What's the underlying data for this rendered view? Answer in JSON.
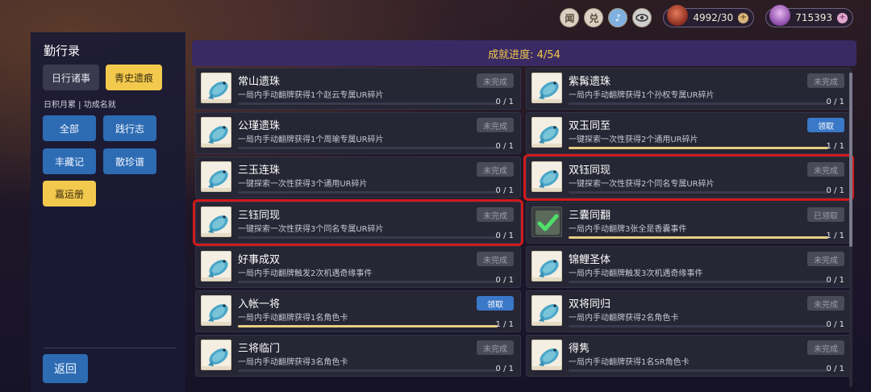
{
  "topbar": {
    "icons": [
      {
        "name": "wen-icon",
        "glyph": "闻"
      },
      {
        "name": "dui-icon",
        "glyph": "兑"
      },
      {
        "name": "music-icon",
        "glyph": "♪"
      },
      {
        "name": "eye-icon",
        "glyph": "👁"
      }
    ],
    "currency1": "4992/30",
    "currency2": "715393",
    "plus": "+"
  },
  "sidebar": {
    "title": "勤行录",
    "tabs": [
      "日行诸事",
      "青史遗痕"
    ],
    "subtitle": "日积月累 | 功成名就",
    "filters": [
      "全部",
      "践行志",
      "丰藏记",
      "散珍谱",
      "嘉运册"
    ],
    "back": "返回"
  },
  "header": {
    "progress": "成就进度: 4/54"
  },
  "achievements": {
    "left": [
      {
        "title": "常山遗珠",
        "desc": "一局内手动翻牌获得1个赵云专属UR碎片",
        "status": "未完成",
        "count": "0 / 1",
        "progress": 0
      },
      {
        "title": "公瑾遗珠",
        "desc": "一局内手动翻牌获得1个周瑜专属UR碎片",
        "status": "未完成",
        "count": "0 / 1",
        "progress": 0
      },
      {
        "title": "三玉连珠",
        "desc": "一键探索一次性获得3个通用UR碎片",
        "status": "未完成",
        "count": "0 / 1",
        "progress": 0
      },
      {
        "title": "三钰同现",
        "desc": "一键探索一次性获得3个同名专属UR碎片",
        "status": "未完成",
        "count": "0 / 1",
        "progress": 0
      },
      {
        "title": "好事成双",
        "desc": "一局内手动翻牌触发2次机遇奇缘事件",
        "status": "未完成",
        "count": "0 / 1",
        "progress": 0
      },
      {
        "title": "入帐一将",
        "desc": "一局内手动翻牌获得1名角色卡",
        "status": "领取",
        "count": "1 / 1",
        "progress": 1
      },
      {
        "title": "三将临门",
        "desc": "一局内手动翻牌获得3名角色卡",
        "status": "未完成",
        "count": "0 / 1",
        "progress": 0
      }
    ],
    "right": [
      {
        "title": "紫髯遗珠",
        "desc": "一局内手动翻牌获得1个孙权专属UR碎片",
        "status": "未完成",
        "count": "0 / 1",
        "progress": 0
      },
      {
        "title": "双玉同至",
        "desc": "一键探索一次性获得2个通用UR碎片",
        "status": "领取",
        "count": "1 / 1",
        "progress": 1
      },
      {
        "title": "双钰同现",
        "desc": "一键探索一次性获得2个同名专属UR碎片",
        "status": "未完成",
        "count": "0 / 1",
        "progress": 0
      },
      {
        "title": "三囊同翻",
        "desc": "一局内手动翻牌3张全是香囊事件",
        "status": "已领取",
        "count": "1 / 1",
        "progress": 1
      },
      {
        "title": "锦鲤圣体",
        "desc": "一局内手动翻牌触发3次机遇奇缘事件",
        "status": "未完成",
        "count": "0 / 1",
        "progress": 0
      },
      {
        "title": "双将同归",
        "desc": "一局内手动翻牌获得2名角色卡",
        "status": "未完成",
        "count": "0 / 1",
        "progress": 0
      },
      {
        "title": "得隽",
        "desc": "一局内手动翻牌获得1名SR角色卡",
        "status": "未完成",
        "count": "0 / 1",
        "progress": 0
      }
    ]
  },
  "colors": {
    "accent_gold": "#f3c94a",
    "claim_blue": "#3a78c8",
    "highlight_red": "#d11a1a"
  }
}
